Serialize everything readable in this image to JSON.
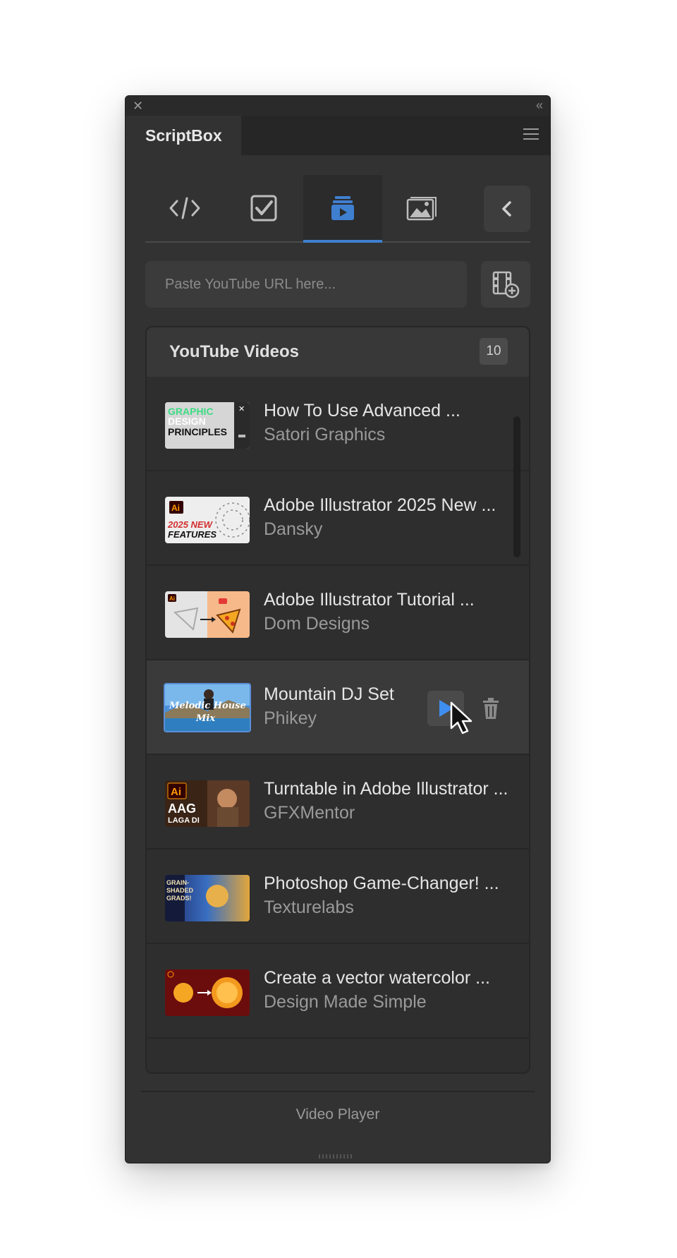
{
  "panel": {
    "title": "ScriptBox",
    "close_glyph": "✕",
    "collapse_glyph": "«",
    "footer": "Video Player"
  },
  "toolbar": {
    "tools": [
      {
        "name": "code-icon",
        "active": false
      },
      {
        "name": "checkbox-icon",
        "active": false
      },
      {
        "name": "video-stack-icon",
        "active": true
      },
      {
        "name": "image-icon",
        "active": false
      }
    ],
    "back_icon": "chevron-left-icon"
  },
  "url": {
    "placeholder": "Paste YouTube URL here...",
    "value": "",
    "add_icon": "add-video-icon"
  },
  "list": {
    "title": "YouTube Videos",
    "count": "10",
    "videos": [
      {
        "title": "How To Use Advanced ...",
        "channel": "Satori Graphics",
        "thumb_text": [
          "GRAPHIC",
          "DESIGN",
          "PRINCIPLES"
        ]
      },
      {
        "title": "Adobe Illustrator 2025 New ...",
        "channel": "Dansky",
        "thumb_text": [
          "Ai",
          "2025 NEW",
          "FEATURES"
        ]
      },
      {
        "title": "Adobe Illustrator Tutorial ...",
        "channel": "Dom Designs",
        "thumb_text": [
          "Ai"
        ]
      },
      {
        "title": "Mountain DJ Set",
        "channel": "Phikey",
        "thumb_text": [
          "Melodic House",
          "Mix"
        ],
        "hovered": true
      },
      {
        "title": "Turntable in Adobe Illustrator ...",
        "channel": "GFXMentor",
        "thumb_text": [
          "Ai",
          "AAG",
          "LAGA DI"
        ]
      },
      {
        "title": "Photoshop Game-Changer! ...",
        "channel": "Texturelabs",
        "thumb_text": [
          "GRAIN-",
          "SHADED",
          "GRADS!"
        ]
      },
      {
        "title": "Create a vector watercolor ...",
        "channel": "Design Made Simple",
        "thumb_text": []
      }
    ]
  },
  "colors": {
    "accent": "#3f7fd0",
    "panel_bg": "#323232"
  }
}
